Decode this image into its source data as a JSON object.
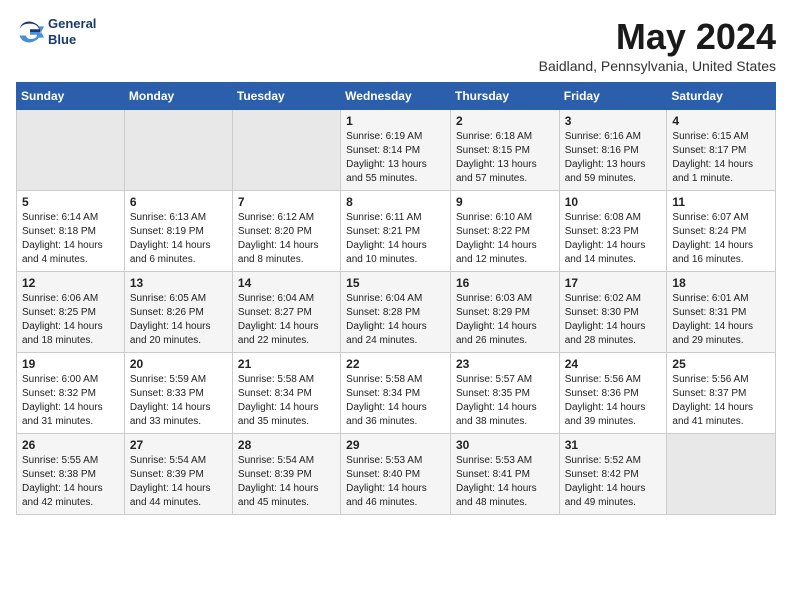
{
  "header": {
    "logo_line1": "General",
    "logo_line2": "Blue",
    "month": "May 2024",
    "location": "Baidland, Pennsylvania, United States"
  },
  "days_of_week": [
    "Sunday",
    "Monday",
    "Tuesday",
    "Wednesday",
    "Thursday",
    "Friday",
    "Saturday"
  ],
  "weeks": [
    [
      {
        "day": "",
        "empty": true
      },
      {
        "day": "",
        "empty": true
      },
      {
        "day": "",
        "empty": true
      },
      {
        "day": "1",
        "sunrise": "Sunrise: 6:19 AM",
        "sunset": "Sunset: 8:14 PM",
        "daylight": "Daylight: 13 hours and 55 minutes."
      },
      {
        "day": "2",
        "sunrise": "Sunrise: 6:18 AM",
        "sunset": "Sunset: 8:15 PM",
        "daylight": "Daylight: 13 hours and 57 minutes."
      },
      {
        "day": "3",
        "sunrise": "Sunrise: 6:16 AM",
        "sunset": "Sunset: 8:16 PM",
        "daylight": "Daylight: 13 hours and 59 minutes."
      },
      {
        "day": "4",
        "sunrise": "Sunrise: 6:15 AM",
        "sunset": "Sunset: 8:17 PM",
        "daylight": "Daylight: 14 hours and 1 minute."
      }
    ],
    [
      {
        "day": "5",
        "sunrise": "Sunrise: 6:14 AM",
        "sunset": "Sunset: 8:18 PM",
        "daylight": "Daylight: 14 hours and 4 minutes."
      },
      {
        "day": "6",
        "sunrise": "Sunrise: 6:13 AM",
        "sunset": "Sunset: 8:19 PM",
        "daylight": "Daylight: 14 hours and 6 minutes."
      },
      {
        "day": "7",
        "sunrise": "Sunrise: 6:12 AM",
        "sunset": "Sunset: 8:20 PM",
        "daylight": "Daylight: 14 hours and 8 minutes."
      },
      {
        "day": "8",
        "sunrise": "Sunrise: 6:11 AM",
        "sunset": "Sunset: 8:21 PM",
        "daylight": "Daylight: 14 hours and 10 minutes."
      },
      {
        "day": "9",
        "sunrise": "Sunrise: 6:10 AM",
        "sunset": "Sunset: 8:22 PM",
        "daylight": "Daylight: 14 hours and 12 minutes."
      },
      {
        "day": "10",
        "sunrise": "Sunrise: 6:08 AM",
        "sunset": "Sunset: 8:23 PM",
        "daylight": "Daylight: 14 hours and 14 minutes."
      },
      {
        "day": "11",
        "sunrise": "Sunrise: 6:07 AM",
        "sunset": "Sunset: 8:24 PM",
        "daylight": "Daylight: 14 hours and 16 minutes."
      }
    ],
    [
      {
        "day": "12",
        "sunrise": "Sunrise: 6:06 AM",
        "sunset": "Sunset: 8:25 PM",
        "daylight": "Daylight: 14 hours and 18 minutes."
      },
      {
        "day": "13",
        "sunrise": "Sunrise: 6:05 AM",
        "sunset": "Sunset: 8:26 PM",
        "daylight": "Daylight: 14 hours and 20 minutes."
      },
      {
        "day": "14",
        "sunrise": "Sunrise: 6:04 AM",
        "sunset": "Sunset: 8:27 PM",
        "daylight": "Daylight: 14 hours and 22 minutes."
      },
      {
        "day": "15",
        "sunrise": "Sunrise: 6:04 AM",
        "sunset": "Sunset: 8:28 PM",
        "daylight": "Daylight: 14 hours and 24 minutes."
      },
      {
        "day": "16",
        "sunrise": "Sunrise: 6:03 AM",
        "sunset": "Sunset: 8:29 PM",
        "daylight": "Daylight: 14 hours and 26 minutes."
      },
      {
        "day": "17",
        "sunrise": "Sunrise: 6:02 AM",
        "sunset": "Sunset: 8:30 PM",
        "daylight": "Daylight: 14 hours and 28 minutes."
      },
      {
        "day": "18",
        "sunrise": "Sunrise: 6:01 AM",
        "sunset": "Sunset: 8:31 PM",
        "daylight": "Daylight: 14 hours and 29 minutes."
      }
    ],
    [
      {
        "day": "19",
        "sunrise": "Sunrise: 6:00 AM",
        "sunset": "Sunset: 8:32 PM",
        "daylight": "Daylight: 14 hours and 31 minutes."
      },
      {
        "day": "20",
        "sunrise": "Sunrise: 5:59 AM",
        "sunset": "Sunset: 8:33 PM",
        "daylight": "Daylight: 14 hours and 33 minutes."
      },
      {
        "day": "21",
        "sunrise": "Sunrise: 5:58 AM",
        "sunset": "Sunset: 8:34 PM",
        "daylight": "Daylight: 14 hours and 35 minutes."
      },
      {
        "day": "22",
        "sunrise": "Sunrise: 5:58 AM",
        "sunset": "Sunset: 8:34 PM",
        "daylight": "Daylight: 14 hours and 36 minutes."
      },
      {
        "day": "23",
        "sunrise": "Sunrise: 5:57 AM",
        "sunset": "Sunset: 8:35 PM",
        "daylight": "Daylight: 14 hours and 38 minutes."
      },
      {
        "day": "24",
        "sunrise": "Sunrise: 5:56 AM",
        "sunset": "Sunset: 8:36 PM",
        "daylight": "Daylight: 14 hours and 39 minutes."
      },
      {
        "day": "25",
        "sunrise": "Sunrise: 5:56 AM",
        "sunset": "Sunset: 8:37 PM",
        "daylight": "Daylight: 14 hours and 41 minutes."
      }
    ],
    [
      {
        "day": "26",
        "sunrise": "Sunrise: 5:55 AM",
        "sunset": "Sunset: 8:38 PM",
        "daylight": "Daylight: 14 hours and 42 minutes."
      },
      {
        "day": "27",
        "sunrise": "Sunrise: 5:54 AM",
        "sunset": "Sunset: 8:39 PM",
        "daylight": "Daylight: 14 hours and 44 minutes."
      },
      {
        "day": "28",
        "sunrise": "Sunrise: 5:54 AM",
        "sunset": "Sunset: 8:39 PM",
        "daylight": "Daylight: 14 hours and 45 minutes."
      },
      {
        "day": "29",
        "sunrise": "Sunrise: 5:53 AM",
        "sunset": "Sunset: 8:40 PM",
        "daylight": "Daylight: 14 hours and 46 minutes."
      },
      {
        "day": "30",
        "sunrise": "Sunrise: 5:53 AM",
        "sunset": "Sunset: 8:41 PM",
        "daylight": "Daylight: 14 hours and 48 minutes."
      },
      {
        "day": "31",
        "sunrise": "Sunrise: 5:52 AM",
        "sunset": "Sunset: 8:42 PM",
        "daylight": "Daylight: 14 hours and 49 minutes."
      },
      {
        "day": "",
        "empty": true
      }
    ]
  ]
}
